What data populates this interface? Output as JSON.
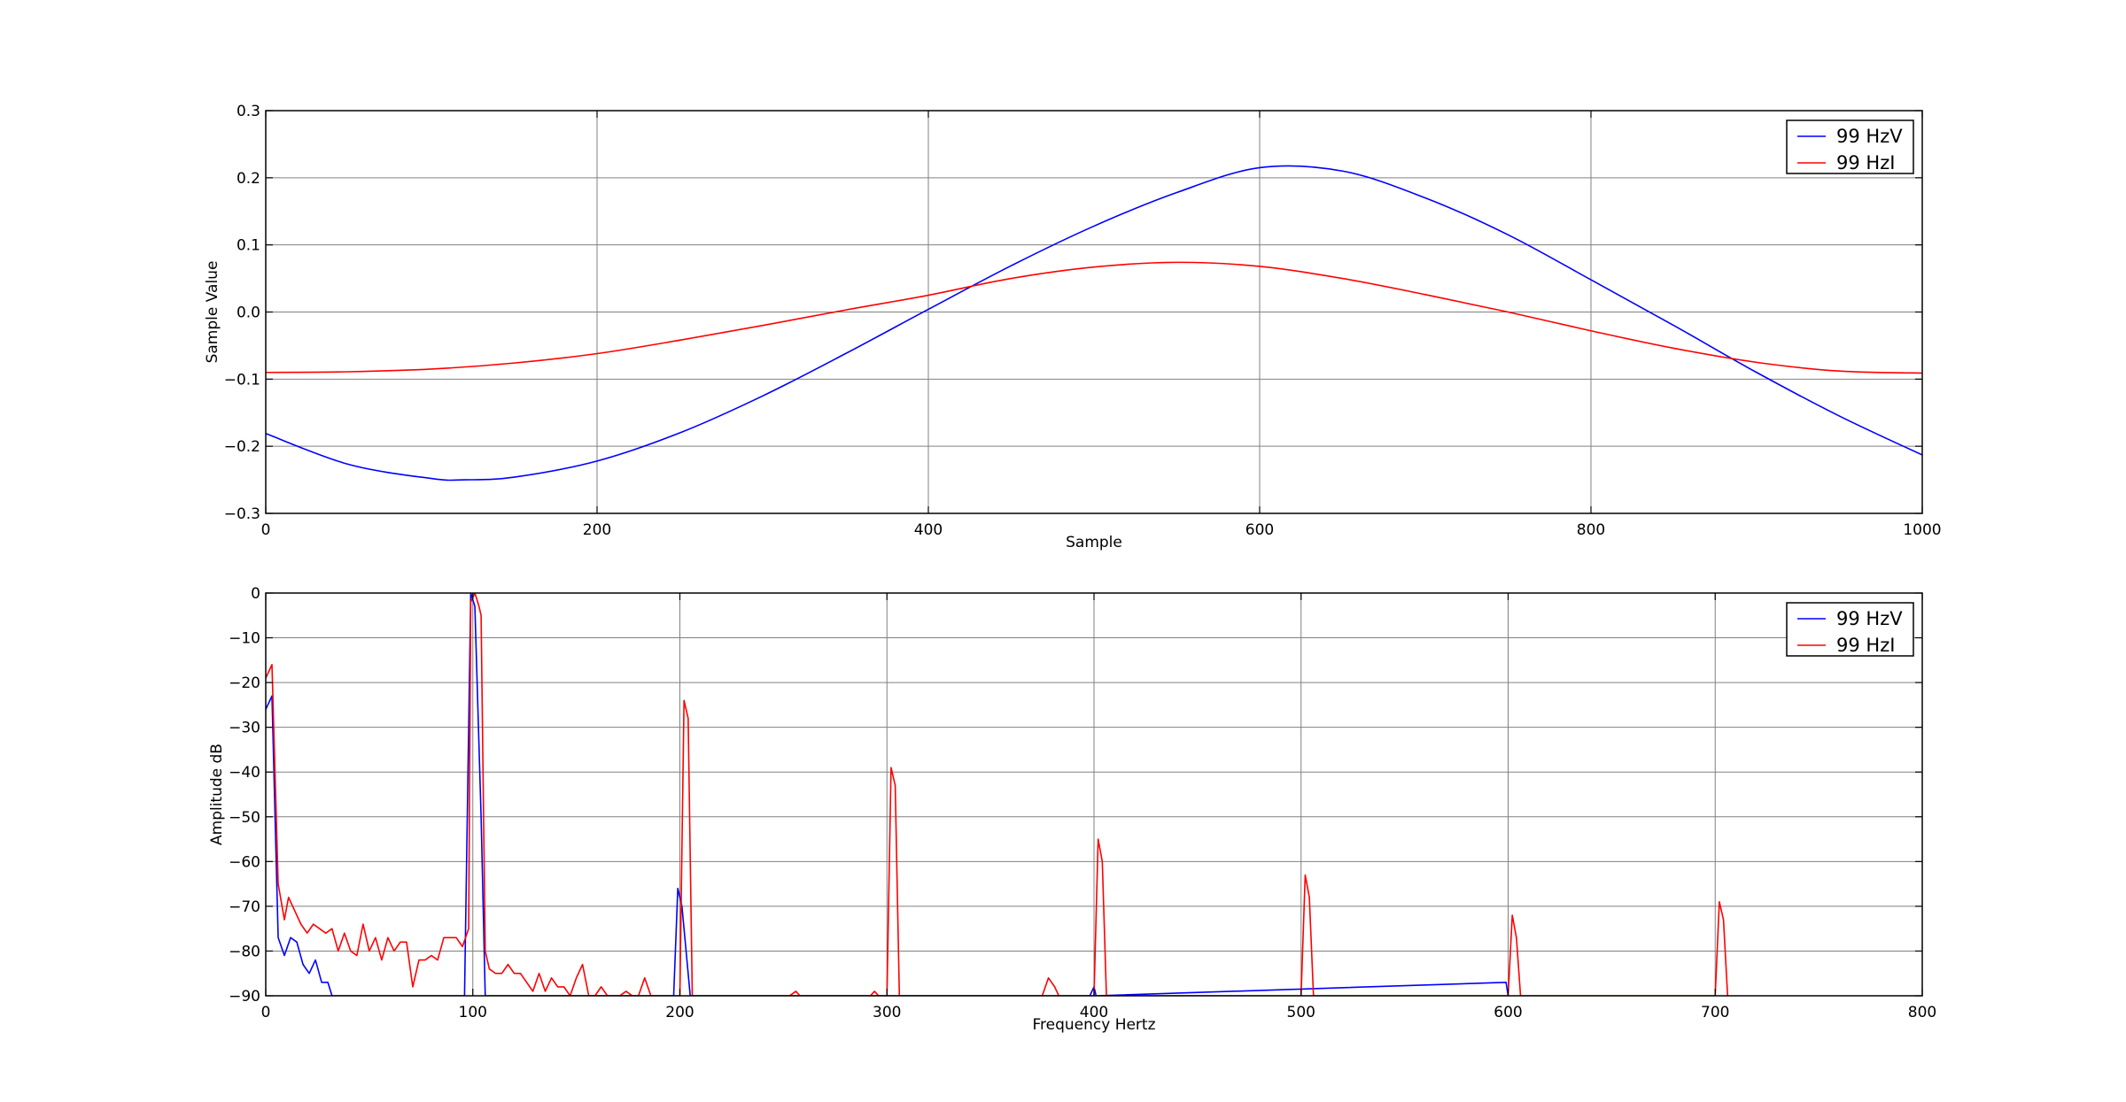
{
  "chart_data": [
    {
      "type": "line",
      "xlabel": "Sample",
      "ylabel": "Sample Value",
      "xlim": [
        0,
        1000
      ],
      "ylim": [
        -0.3,
        0.3
      ],
      "xticks": [
        0,
        200,
        400,
        600,
        800,
        1000
      ],
      "yticks": [
        -0.3,
        -0.2,
        -0.1,
        0.0,
        0.1,
        0.2,
        0.3
      ],
      "xtick_labels": [
        "0",
        "200",
        "400",
        "600",
        "800",
        "1000"
      ],
      "ytick_labels": [
        "−0.3",
        "−0.2",
        "−0.1",
        "0.0",
        "0.1",
        "0.2",
        "0.3"
      ],
      "grid": true,
      "legend": "top-right",
      "series": [
        {
          "name": "99 HzV",
          "color": "#0000ff",
          "x": [
            0,
            50,
            100,
            120,
            150,
            200,
            250,
            300,
            350,
            400,
            450,
            500,
            550,
            600,
            650,
            700,
            750,
            800,
            850,
            900,
            950,
            1000
          ],
          "y": [
            -0.181,
            -0.227,
            -0.248,
            -0.25,
            -0.246,
            -0.222,
            -0.18,
            -0.125,
            -0.062,
            0.004,
            0.069,
            0.128,
            0.178,
            0.215,
            0.21,
            0.17,
            0.115,
            0.048,
            -0.02,
            -0.09,
            -0.155,
            -0.213
          ]
        },
        {
          "name": "99 HzI",
          "color": "#ff0000",
          "x": [
            0,
            50,
            100,
            150,
            200,
            250,
            300,
            350,
            400,
            450,
            500,
            550,
            600,
            650,
            700,
            750,
            800,
            850,
            900,
            950,
            1000
          ],
          "y": [
            -0.09,
            -0.089,
            -0.085,
            -0.076,
            -0.062,
            -0.042,
            -0.02,
            0.003,
            0.025,
            0.05,
            0.067,
            0.074,
            0.068,
            0.05,
            0.026,
            0.0,
            -0.028,
            -0.054,
            -0.075,
            -0.088,
            -0.091
          ]
        }
      ]
    },
    {
      "type": "line",
      "xlabel": "Frequency Hertz",
      "ylabel": "Amplitude dB",
      "xlim": [
        0,
        800
      ],
      "ylim": [
        -90,
        0
      ],
      "xticks": [
        0,
        100,
        200,
        300,
        400,
        500,
        600,
        700,
        800
      ],
      "yticks": [
        -90,
        -80,
        -70,
        -60,
        -50,
        -40,
        -30,
        -20,
        -10,
        0
      ],
      "xtick_labels": [
        "0",
        "100",
        "200",
        "300",
        "400",
        "500",
        "600",
        "700",
        "800"
      ],
      "ytick_labels": [
        "−90",
        "−80",
        "−70",
        "−60",
        "−50",
        "−40",
        "−30",
        "−20",
        "−10",
        "0"
      ],
      "grid": true,
      "legend": "top-right",
      "series": [
        {
          "name": "99 HzV",
          "color": "#0000ff",
          "x": [
            0,
            3,
            6,
            9,
            12,
            15,
            18,
            21,
            24,
            27,
            30,
            32,
            96,
            99,
            101,
            104,
            106,
            197,
            199,
            201,
            203,
            205,
            398,
            400,
            401,
            599,
            600
          ],
          "y": [
            -26,
            -23,
            -77,
            -81,
            -77,
            -78,
            -83,
            -85,
            -82,
            -87,
            -87,
            -90,
            -90,
            0,
            -3,
            -50,
            -90,
            -90,
            -66,
            -70,
            -80,
            -90,
            -90,
            -88,
            -90,
            -87,
            -90
          ]
        },
        {
          "name": "99 HzI",
          "color": "#ff0000",
          "x": [
            0,
            3,
            6,
            9,
            11,
            14,
            17,
            20,
            23,
            26,
            29,
            32,
            35,
            38,
            41,
            44,
            47,
            50,
            53,
            56,
            59,
            62,
            65,
            68,
            71,
            74,
            77,
            80,
            83,
            86,
            89,
            92,
            95,
            98,
            99,
            101,
            103,
            104,
            106,
            108,
            111,
            114,
            117,
            120,
            123,
            126,
            129,
            132,
            135,
            138,
            141,
            144,
            147,
            150,
            153,
            156,
            159,
            162,
            165,
            168,
            171,
            174,
            177,
            180,
            183,
            186,
            190,
            200,
            202,
            204,
            206,
            208,
            250,
            253,
            256,
            258,
            290,
            292,
            294,
            296,
            298,
            300,
            302,
            304,
            306,
            308,
            375,
            378,
            381,
            383,
            398,
            400,
            402,
            404,
            406,
            498,
            500,
            502,
            504,
            506,
            598,
            600,
            602,
            604,
            606,
            698,
            700,
            702,
            704,
            706
          ],
          "y": [
            -19,
            -16,
            -65,
            -73,
            -68,
            -71,
            -74,
            -76,
            -74,
            -75,
            -76,
            -75,
            -80,
            -76,
            -80,
            -81,
            -74,
            -80,
            -77,
            -82,
            -77,
            -80,
            -78,
            -78,
            -88,
            -82,
            -82,
            -81,
            -82,
            -77,
            -77,
            -77,
            -79,
            -75,
            -2,
            0,
            -3,
            -5,
            -80,
            -84,
            -85,
            -85,
            -83,
            -85,
            -85,
            -87,
            -89,
            -85,
            -89,
            -86,
            -88,
            -88,
            -90,
            -86,
            -83,
            -90,
            -90,
            -88,
            -90,
            -90,
            -90,
            -89,
            -90,
            -90,
            -86,
            -90,
            -90,
            -90,
            -24,
            -28,
            -90,
            -90,
            -90,
            -90,
            -89,
            -90,
            -90,
            -90,
            -89,
            -90,
            -90,
            -90,
            -39,
            -43,
            -90,
            -90,
            -90,
            -86,
            -88,
            -90,
            -90,
            -90,
            -55,
            -60,
            -90,
            -90,
            -90,
            -63,
            -68,
            -90,
            -90,
            -90,
            -72,
            -77,
            -90,
            -90,
            -90,
            -69,
            -73,
            -90
          ]
        }
      ]
    }
  ]
}
